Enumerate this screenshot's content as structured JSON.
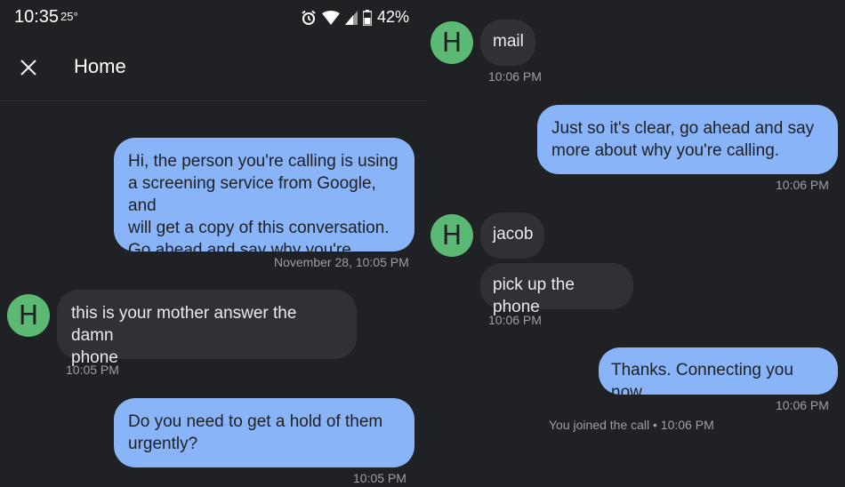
{
  "status_bar": {
    "time": "10:35",
    "temperature": "25°",
    "battery": "42%",
    "icons": [
      "alarm-icon",
      "wifi-icon",
      "signal-icon",
      "battery-icon"
    ]
  },
  "app_bar": {
    "title": "Home",
    "close_icon": "close-icon"
  },
  "left_conversation": {
    "messages": [
      {
        "sender": "assistant",
        "text": "Hi, the person you're calling is using\na screening service from Google, and\nwill get a copy of this conversation.\nGo ahead and say why you're calling.",
        "time": "November 28, 10:05 PM"
      },
      {
        "sender": "caller",
        "avatar": "H",
        "text": "this is your mother answer the damn\nphone",
        "time": "10:05 PM"
      },
      {
        "sender": "assistant",
        "text": "Do you need to get a hold of them\nurgently?",
        "time": "10:05 PM"
      }
    ]
  },
  "right_conversation": {
    "messages": [
      {
        "sender": "caller",
        "avatar": "H",
        "text": "mail",
        "time": "10:06 PM"
      },
      {
        "sender": "assistant",
        "text": "Just so it's clear, go ahead and say\nmore about why you're calling.",
        "time": "10:06 PM"
      },
      {
        "sender": "caller",
        "avatar": "H",
        "text": "jacob"
      },
      {
        "sender": "caller",
        "text": "pick up the phone",
        "time": "10:06 PM"
      },
      {
        "sender": "assistant",
        "text": "Thanks. Connecting you now.",
        "time": "10:06 PM"
      }
    ],
    "system_note": "You joined the call • 10:06 PM"
  },
  "colors": {
    "background": "#202124",
    "outgoing_bubble": "#8ab4f8",
    "incoming_bubble": "#303134",
    "avatar": "#5bb974",
    "timestamp": "#9aa0a6"
  }
}
